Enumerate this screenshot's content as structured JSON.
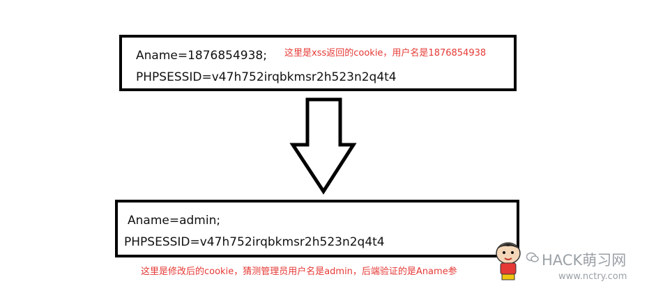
{
  "top_box": {
    "line1": "Aname=1876854938;",
    "line2": "PHPSESSID=v47h752irqbkmsr2h523n2q4t4",
    "note": "这里是xss返回的cookie，用户名是1876854938"
  },
  "bottom_box": {
    "line1": "Aname=admin;",
    "line2": "PHPSESSID=v47h752irqbkmsr2h523n2q4t4"
  },
  "bottom_note": "这里是修改后的cookie，猜测管理员用户名是admin，后端验证的是Aname参",
  "watermark": {
    "brand": "HACK萌习网",
    "url": "www.nctry.com"
  },
  "colors": {
    "border": "#000000",
    "note_red": "#e53935",
    "watermark_gray": "#9aa0a6"
  }
}
